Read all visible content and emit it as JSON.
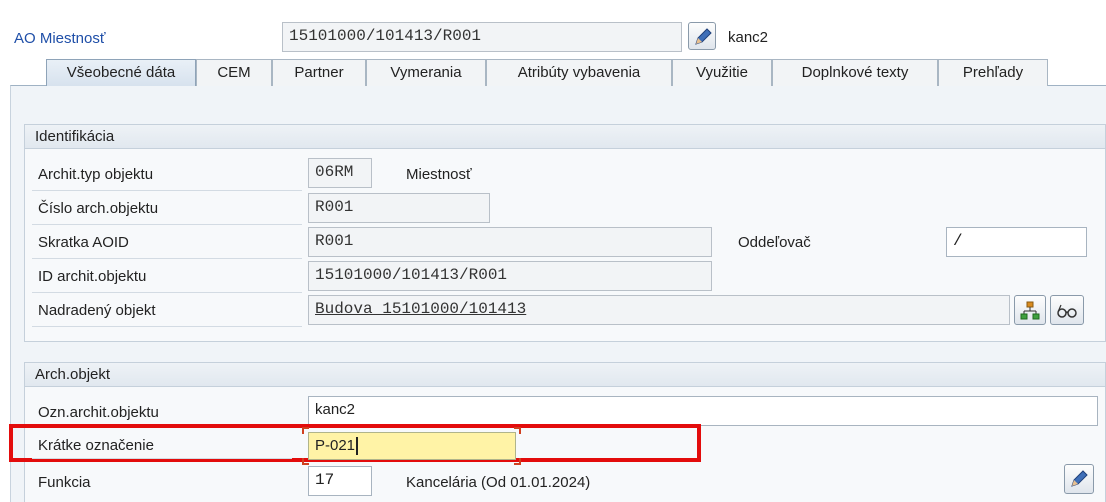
{
  "header": {
    "label": "AO Miestnosť",
    "object_id": "15101000/101413/R001",
    "short_name": "kanc2"
  },
  "tabs": [
    {
      "label": "Všeobecné dáta",
      "active": true
    },
    {
      "label": "CEM"
    },
    {
      "label": "Partner"
    },
    {
      "label": "Vymerania"
    },
    {
      "label": "Atribúty vybavenia"
    },
    {
      "label": "Využitie"
    },
    {
      "label": "Doplnkové texty"
    },
    {
      "label": "Prehľady"
    }
  ],
  "identifikacia": {
    "title": "Identifikácia",
    "archit_typ_label": "Archit.typ objektu",
    "archit_typ_value": "06RM",
    "archit_typ_text": "Miestnosť",
    "cislo_label": "Číslo arch.objektu",
    "cislo_value": "R001",
    "skratka_label": "Skratka AOID",
    "skratka_value": "R001",
    "oddelovac_label": "Oddeľovač",
    "oddelovac_value": "/",
    "id_label": "ID archit.objektu",
    "id_value": "15101000/101413/R001",
    "nadradeny_label": "Nadradený objekt",
    "nadradeny_value": "Budova 15101000/101413"
  },
  "arch_objekt": {
    "title": "Arch.objekt",
    "ozn_label": "Ozn.archit.objektu",
    "ozn_value": "kanc2",
    "kratke_label": "Krátke označenie",
    "kratke_value": "P-021",
    "funkcia_label": "Funkcia",
    "funkcia_value": "17",
    "funkcia_text": "Kancelária (Od 01.01.2024)"
  },
  "colors": {
    "highlight": "#e30c0c",
    "link_blue": "#1f4fa8",
    "active_input": "#fff3a6"
  }
}
